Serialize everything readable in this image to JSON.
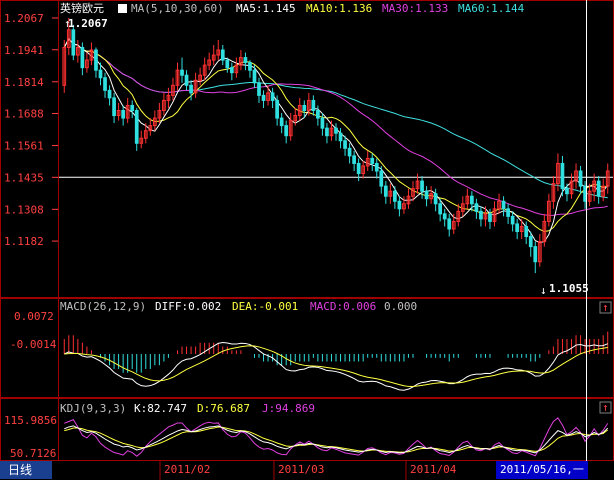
{
  "colors": {
    "border": "#a00000",
    "up": "#ff3030",
    "down": "#30e0e0",
    "ma5": "#ffffff",
    "ma10": "#ffff40",
    "ma30": "#e040e0",
    "ma60": "#40e0e0",
    "axis_text": "#ff4040",
    "white": "#ffffff",
    "diff": "#ffffff",
    "dea": "#ffff40",
    "kdj_k": "#ffffff",
    "kdj_d": "#ffff40",
    "kdj_j": "#e040e0"
  },
  "main": {
    "symbol": "英镑欧元",
    "ma_label": "MA(5,10,30,60)",
    "ma5": "MA5:1.145",
    "ma10": "MA10:1.136",
    "ma30": "MA30:1.133",
    "ma60": "MA60:1.144",
    "high_mark": "1.2067",
    "low_mark": "1.1055",
    "ylim": [
      1.098,
      1.2067
    ],
    "y_ticks": [
      "1.2067",
      "1.1941",
      "1.1814",
      "1.1688",
      "1.1561",
      "1.1435",
      "1.1308",
      "1.1182"
    ],
    "y_tick_values": [
      1.2067,
      1.1941,
      1.1814,
      1.1688,
      1.1561,
      1.1435,
      1.1308,
      1.1182
    ],
    "hline_value": 1.1435
  },
  "macd": {
    "label": "MACD(26,12,9)",
    "diff": "DIFF:0.002",
    "dea": "DEA:-0.001",
    "macd": "MACD:0.006",
    "zero": "0.000",
    "y_ticks": [
      "0.0072",
      "-0.0014"
    ]
  },
  "kdj": {
    "label": "KDJ(9,3,3)",
    "k": "K:82.747",
    "d": "D:76.687",
    "j": "J:94.869",
    "y_ticks": [
      "115.9856",
      "50.7126"
    ]
  },
  "footer": {
    "period_tab": "日线",
    "dates": [
      "2011/02",
      "2011/03",
      "2011/04"
    ],
    "cursor_date": "2011/05/16,一"
  },
  "chart_data": {
    "type": "candlestick",
    "open": [
      1.18,
      1.195,
      1.202,
      1.192,
      1.195,
      1.187,
      1.19,
      1.194,
      1.186,
      1.183,
      1.178,
      1.175,
      1.168,
      1.17,
      1.167,
      1.172,
      1.17,
      1.157,
      1.159,
      1.162,
      1.164,
      1.167,
      1.17,
      1.174,
      1.176,
      1.18,
      1.186,
      1.184,
      1.18,
      1.177,
      1.182,
      1.184,
      1.188,
      1.19,
      1.192,
      1.194,
      1.19,
      1.187,
      1.185,
      1.188,
      1.191,
      1.189,
      1.186,
      1.181,
      1.176,
      1.174,
      1.177,
      1.174,
      1.167,
      1.164,
      1.16,
      1.166,
      1.168,
      1.172,
      1.17,
      1.174,
      1.17,
      1.167,
      1.163,
      1.16,
      1.163,
      1.161,
      1.158,
      1.155,
      1.152,
      1.149,
      1.145,
      1.148,
      1.151,
      1.149,
      1.146,
      1.14,
      1.136,
      1.138,
      1.134,
      1.131,
      1.133,
      1.136,
      1.139,
      1.142,
      1.138,
      1.135,
      1.137,
      1.133,
      1.129,
      1.127,
      1.123,
      1.126,
      1.13,
      1.133,
      1.136,
      1.133,
      1.13,
      1.127,
      1.129,
      1.126,
      1.131,
      1.134,
      1.131,
      1.128,
      1.125,
      1.122,
      1.124,
      1.12,
      1.116,
      1.11,
      1.118,
      1.126,
      1.134,
      1.141,
      1.149,
      1.139,
      1.137,
      1.142,
      1.146,
      1.14,
      1.134,
      1.138,
      1.142,
      1.136,
      1.14
    ],
    "close": [
      1.195,
      1.202,
      1.192,
      1.195,
      1.187,
      1.19,
      1.194,
      1.186,
      1.183,
      1.178,
      1.175,
      1.168,
      1.17,
      1.167,
      1.172,
      1.17,
      1.157,
      1.159,
      1.162,
      1.164,
      1.167,
      1.17,
      1.174,
      1.176,
      1.18,
      1.186,
      1.184,
      1.18,
      1.177,
      1.182,
      1.184,
      1.188,
      1.19,
      1.192,
      1.194,
      1.19,
      1.187,
      1.185,
      1.188,
      1.191,
      1.189,
      1.186,
      1.181,
      1.176,
      1.174,
      1.177,
      1.174,
      1.167,
      1.164,
      1.16,
      1.166,
      1.168,
      1.172,
      1.17,
      1.174,
      1.17,
      1.167,
      1.163,
      1.16,
      1.163,
      1.161,
      1.158,
      1.155,
      1.152,
      1.149,
      1.145,
      1.148,
      1.151,
      1.149,
      1.146,
      1.14,
      1.136,
      1.138,
      1.134,
      1.131,
      1.133,
      1.136,
      1.139,
      1.142,
      1.138,
      1.135,
      1.137,
      1.133,
      1.129,
      1.127,
      1.123,
      1.126,
      1.13,
      1.133,
      1.136,
      1.133,
      1.13,
      1.127,
      1.129,
      1.126,
      1.131,
      1.134,
      1.131,
      1.128,
      1.125,
      1.122,
      1.124,
      1.12,
      1.116,
      1.11,
      1.118,
      1.126,
      1.134,
      1.141,
      1.149,
      1.139,
      1.137,
      1.142,
      1.146,
      1.14,
      1.134,
      1.138,
      1.142,
      1.136,
      1.14,
      1.146
    ],
    "high": [
      1.198,
      1.2067,
      1.204,
      1.198,
      1.197,
      1.193,
      1.197,
      1.195,
      1.189,
      1.185,
      1.18,
      1.177,
      1.173,
      1.172,
      1.175,
      1.174,
      1.171,
      1.162,
      1.165,
      1.167,
      1.17,
      1.173,
      1.177,
      1.179,
      1.183,
      1.189,
      1.191,
      1.186,
      1.182,
      1.185,
      1.187,
      1.191,
      1.193,
      1.196,
      1.198,
      1.196,
      1.191,
      1.189,
      1.191,
      1.194,
      1.193,
      1.19,
      1.188,
      1.183,
      1.178,
      1.18,
      1.179,
      1.176,
      1.169,
      1.166,
      1.169,
      1.171,
      1.175,
      1.174,
      1.177,
      1.176,
      1.172,
      1.169,
      1.165,
      1.166,
      1.165,
      1.163,
      1.16,
      1.157,
      1.154,
      1.151,
      1.15,
      1.154,
      1.153,
      1.151,
      1.148,
      1.142,
      1.141,
      1.14,
      1.136,
      1.136,
      1.139,
      1.142,
      1.145,
      1.144,
      1.14,
      1.14,
      1.139,
      1.135,
      1.131,
      1.129,
      1.129,
      1.133,
      1.136,
      1.139,
      1.138,
      1.135,
      1.132,
      1.132,
      1.131,
      1.134,
      1.137,
      1.136,
      1.133,
      1.13,
      1.127,
      1.127,
      1.126,
      1.122,
      1.118,
      1.121,
      1.129,
      1.137,
      1.144,
      1.153,
      1.152,
      1.141,
      1.145,
      1.149,
      1.148,
      1.142,
      1.141,
      1.145,
      1.144,
      1.143,
      1.149
    ],
    "low": [
      1.177,
      1.192,
      1.19,
      1.189,
      1.184,
      1.185,
      1.188,
      1.183,
      1.18,
      1.175,
      1.172,
      1.165,
      1.166,
      1.164,
      1.165,
      1.167,
      1.154,
      1.155,
      1.157,
      1.16,
      1.162,
      1.165,
      1.168,
      1.171,
      1.174,
      1.178,
      1.181,
      1.178,
      1.174,
      1.175,
      1.18,
      1.182,
      1.186,
      1.188,
      1.19,
      1.188,
      1.185,
      1.182,
      1.183,
      1.186,
      1.186,
      1.183,
      1.179,
      1.173,
      1.171,
      1.172,
      1.171,
      1.164,
      1.161,
      1.157,
      1.158,
      1.164,
      1.166,
      1.167,
      1.168,
      1.168,
      1.164,
      1.16,
      1.157,
      1.158,
      1.158,
      1.155,
      1.152,
      1.149,
      1.146,
      1.142,
      1.143,
      1.146,
      1.146,
      1.143,
      1.137,
      1.133,
      1.133,
      1.131,
      1.128,
      1.129,
      1.131,
      1.134,
      1.137,
      1.135,
      1.132,
      1.133,
      1.13,
      1.126,
      1.124,
      1.12,
      1.121,
      1.124,
      1.128,
      1.131,
      1.13,
      1.127,
      1.124,
      1.124,
      1.123,
      1.124,
      1.129,
      1.128,
      1.125,
      1.122,
      1.119,
      1.119,
      1.117,
      1.112,
      1.1055,
      1.108,
      1.116,
      1.124,
      1.131,
      1.138,
      1.136,
      1.134,
      1.135,
      1.139,
      1.137,
      1.131,
      1.132,
      1.134,
      1.133,
      1.134,
      1.137
    ],
    "macd_hist": [
      0.004,
      0.005,
      0.005,
      0.004,
      0.003,
      0.002,
      0.001,
      0.0,
      -0.001,
      -0.002,
      -0.003,
      -0.004,
      -0.004,
      -0.005,
      -0.005,
      -0.004,
      -0.005,
      -0.005,
      -0.004,
      -0.004,
      -0.003,
      -0.003,
      -0.002,
      -0.001,
      0.0,
      0.001,
      0.002,
      0.002,
      0.002,
      0.002,
      0.003,
      0.003,
      0.003,
      0.003,
      0.003,
      0.002,
      0.002,
      0.001,
      0.001,
      0.001,
      0.0,
      0.0,
      -0.001,
      -0.001,
      -0.002,
      -0.002,
      -0.002,
      -0.003,
      -0.003,
      -0.003,
      -0.003,
      -0.002,
      -0.002,
      -0.002,
      -0.002,
      -0.001,
      -0.002,
      -0.002,
      -0.002,
      -0.002,
      -0.002,
      -0.002,
      -0.002,
      -0.002,
      -0.002,
      -0.002,
      -0.002,
      -0.001,
      -0.001,
      -0.001,
      -0.002,
      -0.002,
      -0.002,
      -0.002,
      -0.002,
      -0.002,
      -0.001,
      -0.001,
      0.0,
      0.0,
      -0.001,
      -0.001,
      -0.001,
      -0.001,
      -0.001,
      -0.002,
      -0.001,
      -0.001,
      0.0,
      0.0,
      0.0,
      -0.001,
      -0.001,
      -0.001,
      -0.001,
      0.0,
      0.0,
      0.0,
      -0.001,
      -0.001,
      -0.001,
      -0.001,
      -0.001,
      -0.002,
      -0.002,
      -0.001,
      0.0,
      0.001,
      0.002,
      0.004,
      0.004,
      0.004,
      0.004,
      0.005,
      0.005,
      0.004,
      0.004,
      0.004,
      0.004,
      0.005,
      0.006
    ],
    "kdj_k": [
      80,
      85,
      88,
      82,
      75,
      70,
      72,
      68,
      60,
      52,
      45,
      38,
      35,
      30,
      32,
      28,
      22,
      25,
      30,
      36,
      42,
      48,
      55,
      62,
      68,
      74,
      78,
      76,
      72,
      74,
      78,
      82,
      85,
      86,
      88,
      82,
      76,
      72,
      70,
      74,
      72,
      66,
      58,
      50,
      44,
      42,
      38,
      32,
      28,
      25,
      30,
      34,
      38,
      36,
      40,
      38,
      34,
      30,
      28,
      30,
      28,
      25,
      22,
      20,
      18,
      16,
      18,
      22,
      24,
      22,
      18,
      15,
      17,
      16,
      14,
      15,
      20,
      26,
      32,
      30,
      26,
      28,
      24,
      20,
      18,
      15,
      18,
      24,
      30,
      34,
      30,
      26,
      24,
      26,
      24,
      30,
      34,
      30,
      26,
      22,
      20,
      22,
      20,
      17,
      14,
      22,
      34,
      48,
      62,
      75,
      70,
      62,
      66,
      72,
      68,
      58,
      62,
      70,
      64,
      70,
      82
    ],
    "kdj_d": [
      75,
      78,
      82,
      82,
      80,
      76,
      74,
      72,
      68,
      62,
      56,
      50,
      45,
      40,
      37,
      34,
      30,
      28,
      29,
      32,
      36,
      40,
      45,
      51,
      57,
      63,
      69,
      72,
      72,
      72,
      74,
      77,
      80,
      82,
      85,
      84,
      81,
      78,
      75,
      75,
      74,
      71,
      66,
      60,
      54,
      50,
      46,
      41,
      37,
      33,
      32,
      33,
      35,
      35,
      37,
      38,
      36,
      34,
      32,
      31,
      30,
      28,
      26,
      24,
      22,
      20,
      19,
      20,
      22,
      22,
      20,
      18,
      18,
      17,
      16,
      16,
      17,
      20,
      24,
      26,
      26,
      27,
      26,
      24,
      22,
      19,
      19,
      21,
      24,
      28,
      29,
      28,
      26,
      26,
      25,
      27,
      30,
      30,
      28,
      26,
      24,
      23,
      22,
      20,
      18,
      20,
      25,
      33,
      43,
      54,
      60,
      61,
      63,
      66,
      67,
      64,
      63,
      65,
      65,
      67,
      77
    ],
    "kdj_j": [
      95,
      100,
      105,
      85,
      62,
      55,
      68,
      58,
      40,
      30,
      22,
      15,
      12,
      8,
      20,
      15,
      5,
      15,
      32,
      45,
      55,
      65,
      75,
      85,
      90,
      96,
      96,
      82,
      72,
      80,
      88,
      95,
      98,
      95,
      96,
      78,
      65,
      58,
      60,
      72,
      68,
      55,
      40,
      30,
      24,
      26,
      22,
      14,
      10,
      9,
      25,
      36,
      44,
      38,
      46,
      38,
      28,
      22,
      20,
      28,
      24,
      19,
      14,
      12,
      10,
      8,
      16,
      26,
      28,
      22,
      14,
      9,
      15,
      14,
      10,
      13,
      26,
      38,
      48,
      38,
      26,
      30,
      20,
      12,
      10,
      7,
      16,
      30,
      42,
      46,
      32,
      22,
      20,
      26,
      22,
      36,
      42,
      30,
      22,
      14,
      12,
      20,
      16,
      11,
      6,
      26,
      52,
      78,
      100,
      110,
      90,
      64,
      72,
      84,
      70,
      46,
      60,
      80,
      62,
      76,
      94.869
    ]
  }
}
